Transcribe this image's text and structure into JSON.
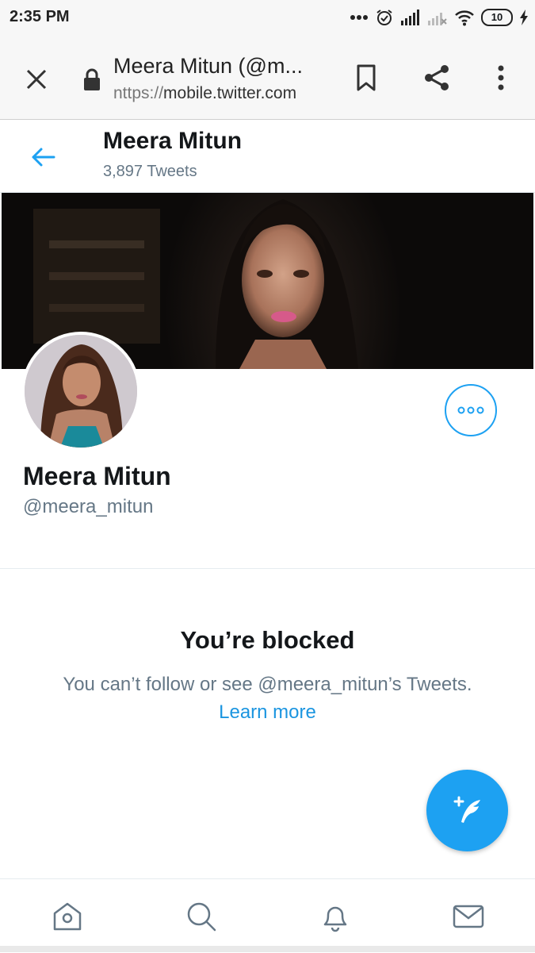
{
  "status_bar": {
    "time": "2:35 PM",
    "battery": "10",
    "icons": [
      "dots-icon",
      "alarm-icon",
      "signal-icon",
      "signal-off-icon",
      "wifi-icon",
      "battery-icon",
      "charging-icon"
    ]
  },
  "browser": {
    "title": "Meera Mitun (@m...",
    "url_protocol": "nttps://",
    "url_host": "mobile.twitter.com",
    "icons": [
      "close-icon",
      "lock-icon",
      "bookmark-icon",
      "share-icon",
      "overflow-menu-icon"
    ]
  },
  "header": {
    "name": "Meera Mitun",
    "tweet_count": "3,897 Tweets"
  },
  "profile": {
    "name": "Meera Mitun",
    "handle": "@meera_mitun"
  },
  "blocked": {
    "title": "You’re blocked",
    "description": "You can’t follow or see @meera_mitun’s Tweets.",
    "learn_more": "Learn more"
  },
  "bottom_nav": [
    "home-icon",
    "search-icon",
    "notifications-icon",
    "messages-icon"
  ],
  "colors": {
    "accent": "#1da1f2",
    "link": "#1b95e0",
    "secondary_text": "#657786",
    "primary_text": "#14171a"
  }
}
